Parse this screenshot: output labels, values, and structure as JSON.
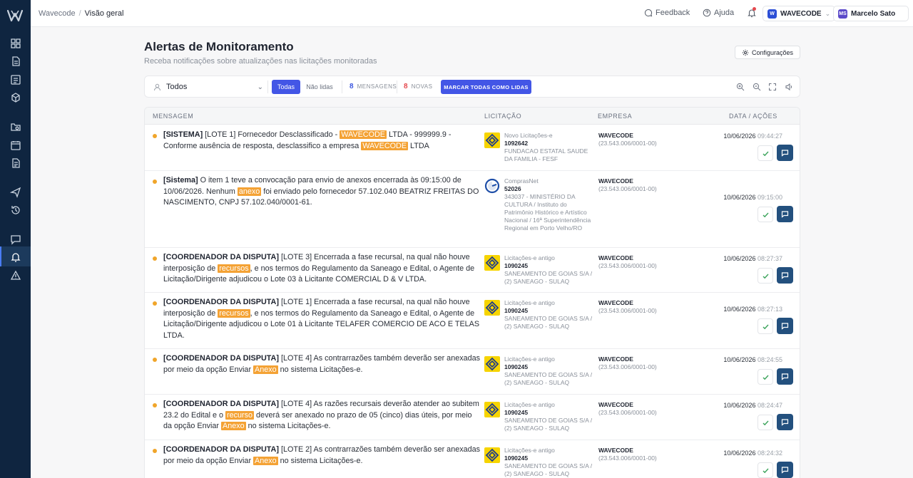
{
  "breadcrumb": {
    "root": "Wavecode",
    "separator": "/",
    "current": "Visão geral"
  },
  "topbar": {
    "feedback": "Feedback",
    "help": "Ajuda",
    "org": {
      "initial": "W",
      "name": "WAVECODE"
    },
    "user": {
      "initials": "MS",
      "name": "Marcelo Sato"
    }
  },
  "page": {
    "title": "Alertas de Monitoramento",
    "subtitle": "Receba notificações sobre atualizações nas licitações monitoradas",
    "settings_label": "Configurações"
  },
  "filters": {
    "select_value": "Todos",
    "tab_all": "Todas",
    "tab_unread": "Não lidas",
    "messages_count": "8",
    "messages_label": "MENSAGENS",
    "new_count": "8",
    "new_label": "NOVAS",
    "mark_all": "MARCAR TODAS COMO LIDAS"
  },
  "table": {
    "headers": {
      "message": "MENSAGEM",
      "licitacao": "LICITAÇÃO",
      "empresa": "EMPRESA",
      "date": "DATA / AÇÕES"
    },
    "rows": [
      {
        "message": [
          {
            "t": "[SISTEMA]",
            "s": "b"
          },
          {
            "t": " [LOTE 1] Fornecedor Desclassificado - "
          },
          {
            "t": "WAVECODE",
            "s": "h"
          },
          {
            "t": " LTDA - 999999.9 - Conforme ausência de resposta, desclassifico a empresa "
          },
          {
            "t": "WAVECODE",
            "s": "h"
          },
          {
            "t": " LTDA"
          }
        ],
        "portal": "Novo Licitações-e",
        "number": "1092642",
        "org": "FUNDACAO ESTATAL SAUDE DA FAMILIA - FESF",
        "logo": "bb",
        "company": "WAVECODE",
        "cnpj": "(23.543.006/0001-00)",
        "date": "10/06/2026",
        "time": "09:44:27"
      },
      {
        "message": [
          {
            "t": "[Sistema]",
            "s": "b"
          },
          {
            "t": " O item 1 teve a convocação para envio de anexos encerrada às 09:15:00 de 10/06/2026. Nenhum "
          },
          {
            "t": "anexo",
            "s": "h"
          },
          {
            "t": " foi enviado pelo fornecedor 57.102.040 BEATRIZ FREITAS DO NASCIMENTO, CNPJ 57.102.040/0001-61."
          }
        ],
        "portal": "ComprasNet",
        "number": "52026",
        "org": "343037 - MINISTÉRIO DA CULTURA / Instituto do Patrimônio Histórico e Artístico Nacional / 16ª Superintendência Regional em Porto Velho/RO",
        "logo": "cn",
        "company": "WAVECODE",
        "cnpj": "(23.543.006/0001-00)",
        "date": "10/06/2026",
        "time": "09:15:00"
      },
      {
        "message": [
          {
            "t": "[COORDENADOR DA DISPUTA]",
            "s": "b"
          },
          {
            "t": " [LOTE 3] Encerrada a fase recursal, na qual não houve interposição de "
          },
          {
            "t": "recursos",
            "s": "h"
          },
          {
            "t": ", e nos termos do Regulamento da Saneago e Edital, o Agente de Licitação/Dirigente adjudicou o Lote 03 à Licitante COMERCIAL D & V LTDA."
          }
        ],
        "portal": "Licitações-e antigo",
        "number": "1090245",
        "org": "SANEAMENTO DE GOIAS S/A / (2) SANEAGO - SULAQ",
        "logo": "bb",
        "company": "WAVECODE",
        "cnpj": "(23.543.006/0001-00)",
        "date": "10/06/2026",
        "time": "08:27:37"
      },
      {
        "message": [
          {
            "t": "[COORDENADOR DA DISPUTA]",
            "s": "b"
          },
          {
            "t": " [LOTE 1] Encerrada a fase recursal, na qual não houve interposição de "
          },
          {
            "t": "recursos",
            "s": "h"
          },
          {
            "t": ", e nos termos do Regulamento da Saneago e Edital, o Agente de Licitação/Dirigente adjudicou o Lote 01 à Licitante TELAFER COMERCIO DE ACO E TELAS LTDA."
          }
        ],
        "portal": "Licitações-e antigo",
        "number": "1090245",
        "org": "SANEAMENTO DE GOIAS S/A / (2) SANEAGO - SULAQ",
        "logo": "bb",
        "company": "WAVECODE",
        "cnpj": "(23.543.006/0001-00)",
        "date": "10/06/2026",
        "time": "08:27:13"
      },
      {
        "message": [
          {
            "t": "[COORDENADOR DA DISPUTA]",
            "s": "b"
          },
          {
            "t": " [LOTE 4] As contrarrazões também deverão ser anexadas por meio da opção  Enviar "
          },
          {
            "t": "Anexo",
            "s": "h"
          },
          {
            "t": "  no sistema Licitações-e."
          }
        ],
        "portal": "Licitações-e antigo",
        "number": "1090245",
        "org": "SANEAMENTO DE GOIAS S/A / (2) SANEAGO - SULAQ",
        "logo": "bb",
        "company": "WAVECODE",
        "cnpj": "(23.543.006/0001-00)",
        "date": "10/06/2026",
        "time": "08:24:55"
      },
      {
        "message": [
          {
            "t": "[COORDENADOR DA DISPUTA]",
            "s": "b"
          },
          {
            "t": " [LOTE 4] As razões recursais deverão atender ao subitem 23.2 do Edital e o "
          },
          {
            "t": "recurso",
            "s": "h"
          },
          {
            "t": " deverá ser anexado no prazo de 05 (cinco) dias úteis, por meio da opção  Enviar "
          },
          {
            "t": "Anexo",
            "s": "h"
          },
          {
            "t": "  no sistema Licitações-e."
          }
        ],
        "portal": "Licitações-e antigo",
        "number": "1090245",
        "org": "SANEAMENTO DE GOIAS S/A / (2) SANEAGO - SULAQ",
        "logo": "bb",
        "company": "WAVECODE",
        "cnpj": "(23.543.006/0001-00)",
        "date": "10/06/2026",
        "time": "08:24:47"
      },
      {
        "message": [
          {
            "t": "[COORDENADOR DA DISPUTA]",
            "s": "b"
          },
          {
            "t": " [LOTE 2] As contrarrazões também deverão ser anexadas por meio da opção  Enviar "
          },
          {
            "t": "Anexo",
            "s": "h"
          },
          {
            "t": "  no sistema Licitações-e."
          }
        ],
        "portal": "Licitações-e antigo",
        "number": "1090245",
        "org": "SANEAMENTO DE GOIAS S/A / (2) SANEAGO - SULAQ",
        "logo": "bb",
        "company": "WAVECODE",
        "cnpj": "(23.543.006/0001-00)",
        "date": "10/06/2026",
        "time": "08:24:32"
      }
    ]
  },
  "colors": {
    "accent": "#4356e6",
    "sidebar": "#0f2540",
    "highlight": "#f4a234",
    "unread_dot": "#f0a52a",
    "action": "#23507e"
  },
  "icons": {
    "sidebar": [
      "dashboard-icon",
      "document-icon",
      "list-icon",
      "package-icon",
      "folder-search-icon",
      "calendar-icon",
      "file-text-icon",
      "send-icon",
      "history-icon",
      "chat-icon",
      "bell-icon",
      "alert-icon"
    ]
  }
}
